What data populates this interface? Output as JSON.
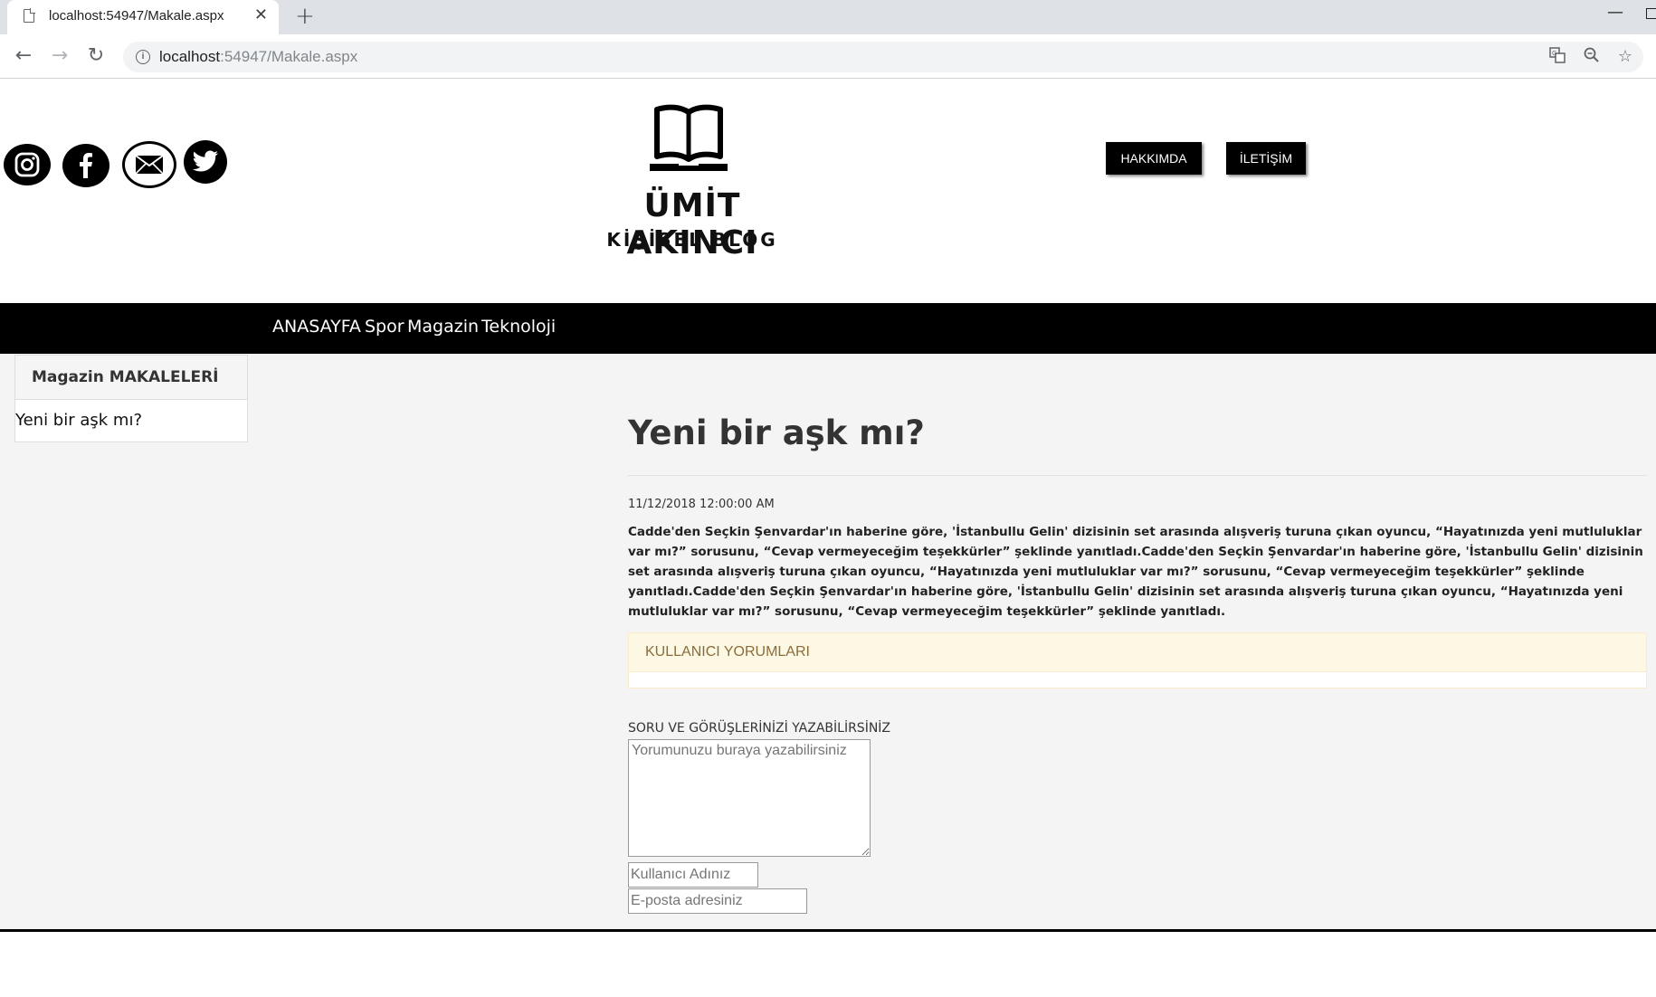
{
  "browser": {
    "tab_title": "localhost:54947/Makale.aspx",
    "url_host": "localhost",
    "url_path": ":54947/Makale.aspx",
    "icons": [
      "page-icon",
      "close-icon",
      "plus-icon",
      "back-icon",
      "forward-icon",
      "reload-icon",
      "info-icon",
      "translate-icon",
      "zoom-icon",
      "star-icon",
      "minimize-icon",
      "maximize-icon"
    ]
  },
  "header": {
    "social_icons": [
      "instagram-icon",
      "facebook-icon",
      "mail-icon",
      "twitter-icon"
    ],
    "logo_name": "ÜMİT AKINCI",
    "logo_sub": "KİŞİSEL BLOG",
    "about_button": "HAKKIMDA",
    "contact_button": "İLETİŞİM"
  },
  "nav": {
    "items": [
      "ANASAYFA",
      "Spor",
      "Magazin",
      "Teknoloji"
    ]
  },
  "sidebar": {
    "heading": "Magazin MAKALELERİ",
    "items": [
      "Yeni bir aşk mı?"
    ]
  },
  "article": {
    "title": "Yeni bir aşk mı?",
    "date": "11/12/2018 12:00:00 AM",
    "body": "Cadde'den Seçkin Şenvardar'ın haberine göre, 'İstanbullu Gelin' dizisinin set arasında alışveriş turuna çıkan oyuncu, “Hayatınızda yeni mutluluklar var mı?” sorusunu, “Cevap vermeyeceğim teşekkürler” şeklinde yanıtladı.Cadde'den Seçkin Şenvardar'ın haberine göre, 'İstanbullu Gelin' dizisinin set arasında alışveriş turuna çıkan oyuncu, “Hayatınızda yeni mutluluklar var mı?” sorusunu, “Cevap vermeyeceğim teşekkürler” şeklinde yanıtladı.Cadde'den Seçkin Şenvardar'ın haberine göre, 'İstanbullu Gelin' dizisinin set arasında alışveriş turuna çıkan oyuncu, “Hayatınızda yeni mutluluklar var mı?” sorusunu, “Cevap vermeyeceğim teşekkürler” şeklinde yanıtladı."
  },
  "comments": {
    "heading": "KULLANICI YORUMLARI"
  },
  "form": {
    "label": "SORU VE GÖRÜŞLERİNİZİ YAZABİLİRSİNİZ",
    "comment_placeholder": "Yorumunuzu buraya yazabilirsiniz",
    "username_placeholder": "Kullanıcı Adınız",
    "email_placeholder": "E-posta adresiniz"
  }
}
